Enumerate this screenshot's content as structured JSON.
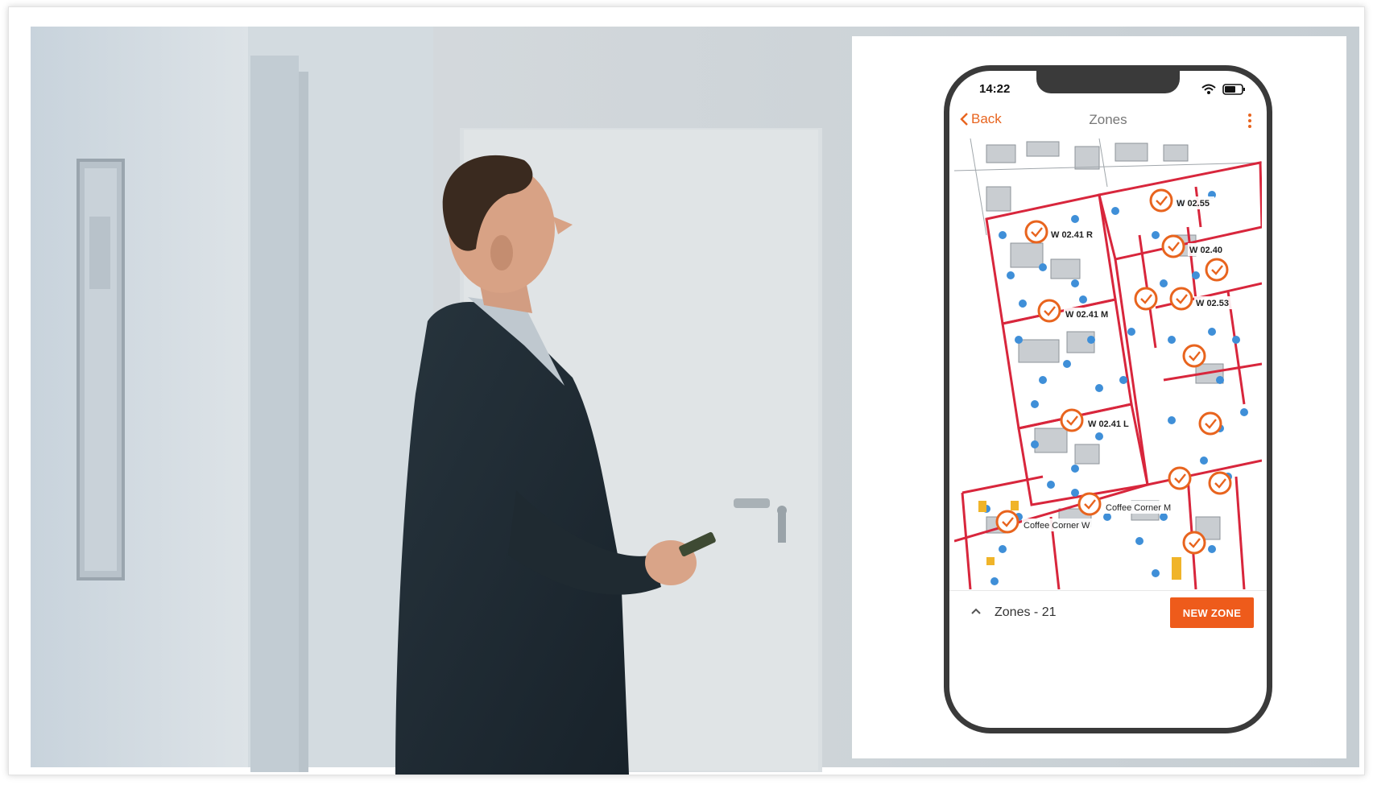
{
  "phone": {
    "status_time": "14:22",
    "nav": {
      "back_label": "Back",
      "title": "Zones"
    },
    "zones": [
      {
        "label": "W 02.55"
      },
      {
        "label": "W 02.41 R"
      },
      {
        "label": "W 02.40"
      },
      {
        "label": "W 02.41 M"
      },
      {
        "label": "W 02.53"
      },
      {
        "label": "W 02.41 L"
      },
      {
        "label": "Coffee Corner M"
      },
      {
        "label": "Coffee Corner W"
      }
    ],
    "bottom_sheet": {
      "zones_count_label": "Zones - 21",
      "new_zone_label": "NEW ZONE"
    }
  },
  "colors": {
    "accent": "#ee5b1b",
    "zone_border": "#d8263c",
    "marker": "#e8641e",
    "seat_dot": "#3f8fd8"
  },
  "icons": [
    "wifi-icon",
    "battery-icon",
    "chevron-left-icon",
    "more-vertical-icon",
    "chevron-up-icon",
    "check-circle-icon"
  ]
}
